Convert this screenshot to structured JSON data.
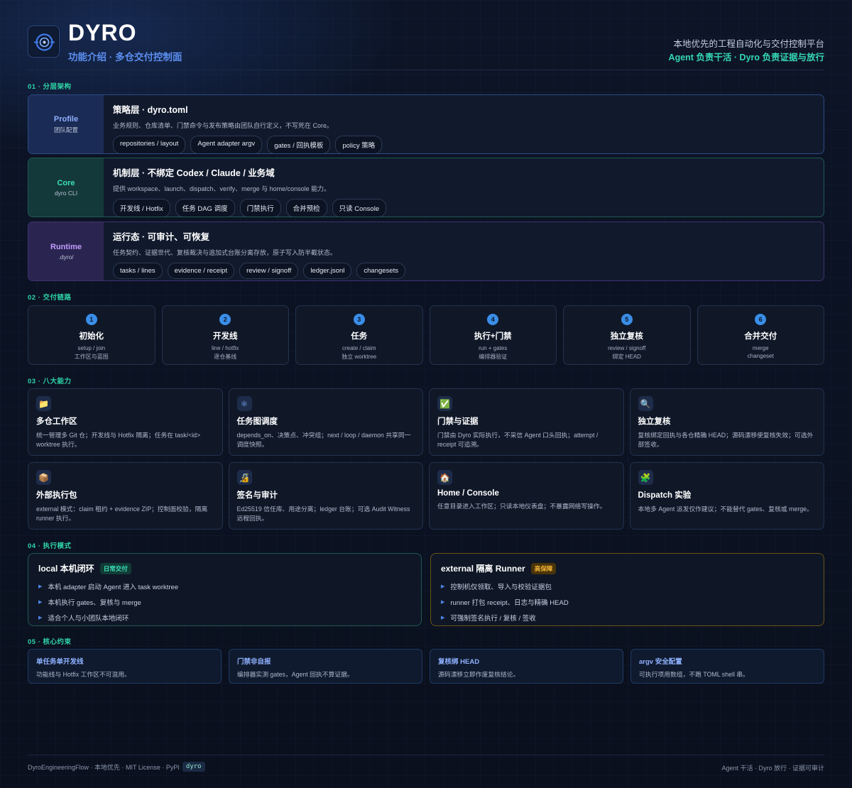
{
  "header": {
    "brand": "DYRO",
    "subtitle": "功能介绍 · 多仓交付控制面",
    "tagline_1": "本地优先的工程自动化与交付控制平台",
    "tagline_2": "Agent 负责干活 · Dyro 负责证据与放行"
  },
  "sections": {
    "s1": "01 · 分层架构",
    "s2": "02 · 交付链路",
    "s3": "03 · 八大能力",
    "s4": "04 · 执行模式",
    "s5": "05 · 核心约束"
  },
  "layers": [
    {
      "name": "Profile",
      "sub": "团队配置",
      "title": "策略层 · dyro.toml",
      "desc": "业务规则、仓库清单、门禁命令与发布策略由团队自行定义，不写死在 Core。",
      "chips": [
        "repositories / layout",
        "Agent adapter argv",
        "gates / 回执模板",
        "policy 策略"
      ]
    },
    {
      "name": "Core",
      "sub": "dyro CLI",
      "title": "机制层 · 不绑定 Codex / Claude / 业务域",
      "desc": "提供 workspace、launch、dispatch、verify、merge 与 home/console 能力。",
      "chips": [
        "开发线 / Hotfix",
        "任务 DAG 调度",
        "门禁执行",
        "合并预检",
        "只读 Console"
      ]
    },
    {
      "name": "Runtime",
      "sub": ".dyro/",
      "title": "运行态 · 可审计、可恢复",
      "desc": "任务契约、证据世代、复核裁决与追加式台账分离存放，原子写入防半截状态。",
      "chips": [
        "tasks / lines",
        "evidence / receipt",
        "review / signoff",
        "ledger.jsonl",
        "changesets"
      ]
    }
  ],
  "steps": [
    {
      "num": "1",
      "title": "初始化",
      "line1": "setup / join",
      "line2": "工作区与蓝图"
    },
    {
      "num": "2",
      "title": "开发线",
      "line1": "line / hotfix",
      "line2": "逐仓基线"
    },
    {
      "num": "3",
      "title": "任务",
      "line1": "create / claim",
      "line2": "独立 worktree"
    },
    {
      "num": "4",
      "title": "执行+门禁",
      "line1": "run + gates",
      "line2": "编排器验证"
    },
    {
      "num": "5",
      "title": "独立复核",
      "line1": "review / signoff",
      "line2": "绑定 HEAD"
    },
    {
      "num": "6",
      "title": "合并交付",
      "line1": "merge",
      "line2": "changeset"
    }
  ],
  "features": [
    {
      "icon": "📁",
      "icon_name": "folder-icon",
      "title": "多仓工作区",
      "desc": "统一管理多 Git 仓；开发线与 Hotfix 隔离；任务在 task/<id> worktree 执行。"
    },
    {
      "icon": "⚛",
      "icon_name": "graph-icon",
      "title": "任务图调度",
      "desc": "depends_on、决策点、冲突组；next / loop / daemon 共享同一调度快照。"
    },
    {
      "icon": "✅",
      "icon_name": "check-icon",
      "title": "门禁与证据",
      "desc": "门禁由 Dyro 实际执行，不采信 Agent 口头回执；attempt / receipt 可追溯。"
    },
    {
      "icon": "🔍",
      "icon_name": "magnifier-icon",
      "title": "独立复核",
      "desc": "复核绑定回执与各仓精确 HEAD；源码漂移使复核失效；可选外部签收。"
    },
    {
      "icon": "📦",
      "icon_name": "package-icon",
      "title": "外部执行包",
      "desc": "external 模式：claim 租约 + evidence ZIP；控制面校验，隔离 runner 执行。"
    },
    {
      "icon": "🔏",
      "icon_name": "lock-icon",
      "title": "签名与审计",
      "desc": "Ed25519 信任库、用途分离；ledger 台账；可选 Audit Witness 远程回执。"
    },
    {
      "icon": "🏠",
      "icon_name": "home-icon",
      "title": "Home / Console",
      "desc": "任意目录进入工作区；只读本地仪表盘；不暴露网络写操作。"
    },
    {
      "icon": "🧩",
      "icon_name": "puzzle-icon",
      "title": "Dispatch 实验",
      "desc": "本地多 Agent 派发仅作建议；不能替代 gates、复核或 merge。"
    }
  ],
  "modes": {
    "local": {
      "title": "local 本机闭环",
      "badge": "日常交付",
      "items": [
        "本机 adapter 启动 Agent 进入 task worktree",
        "本机执行 gates、复核与 merge",
        "适合个人与小团队本地闭环"
      ]
    },
    "external": {
      "title": "external 隔离 Runner",
      "badge": "高保障",
      "items": [
        "控制机仅领取、导入与校验证据包",
        "runner 打包 receipt、日志与精确 HEAD",
        "可强制签名执行 / 复核 / 签收"
      ]
    }
  },
  "constraints": [
    {
      "title": "单任务单开发线",
      "desc": "功能线与 Hotfix 工作区不可混用。"
    },
    {
      "title": "门禁非自报",
      "desc": "编排器实测 gates，Agent 回执不算证据。"
    },
    {
      "title": "复核绑 HEAD",
      "desc": "源码漂移立即作废复核结论。"
    },
    {
      "title": "argv 安全配置",
      "desc": "可执行项用数组，不跑 TOML shell 串。"
    }
  ],
  "footer": {
    "left_text": "DyroEngineeringFlow · 本地优先 · MIT License · PyPI",
    "code": "dyro",
    "right_text": "Agent 干活 · Dyro 放行 · 证据可审计"
  },
  "colors": {
    "accent_teal": "#2fd4a8",
    "accent_blue": "#5b8ef0",
    "profile": "#8fb1ff",
    "core": "#3be0b8",
    "runtime": "#c19cff",
    "warning": "#f2b43a"
  }
}
